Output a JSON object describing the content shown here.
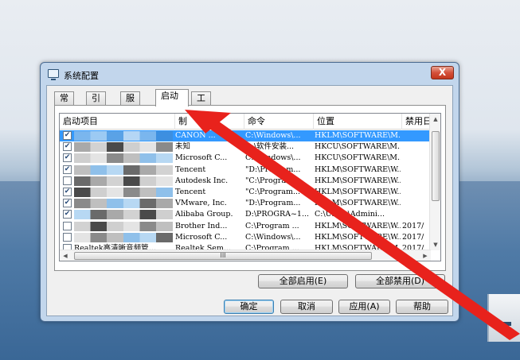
{
  "window": {
    "title": "系统配置",
    "close_glyph": "X"
  },
  "tabs": [
    {
      "label": "常规",
      "active": false
    },
    {
      "label": "引导",
      "active": false
    },
    {
      "label": "服务",
      "active": false
    },
    {
      "label": "启动",
      "active": true
    },
    {
      "label": "工具",
      "active": false
    }
  ],
  "table": {
    "columns": [
      "启动项目",
      "制",
      "命令",
      "位置",
      "禁用日"
    ],
    "rows": [
      {
        "checked": true,
        "name": "",
        "manufacturer": "CANON ...",
        "command": "C:\\Windows\\...",
        "location": "HKLM\\SOFTWARE\\M...",
        "date": "",
        "selected": true
      },
      {
        "checked": true,
        "name": "",
        "manufacturer": "未知",
        "command": "D:\\软件安装...",
        "location": "HKCU\\SOFTWARE\\M...",
        "date": "",
        "selected": false
      },
      {
        "checked": true,
        "name": "",
        "manufacturer": "Microsoft C...",
        "command": "C:\\Windows\\...",
        "location": "HKCU\\SOFTWARE\\M...",
        "date": "",
        "selected": false
      },
      {
        "checked": true,
        "name": "",
        "manufacturer": "Tencent",
        "command": "\"D:\\Program...",
        "location": "HKLM\\SOFTWARE\\W...",
        "date": "",
        "selected": false
      },
      {
        "checked": false,
        "name": "",
        "manufacturer": "Autodesk Inc.",
        "command": "\"C:\\Program...",
        "location": "HKLM\\SOFTWARE\\W...",
        "date": "",
        "selected": false
      },
      {
        "checked": true,
        "name": "",
        "manufacturer": "Tencent",
        "command": "\"C:\\Program...",
        "location": "HKLM\\SOFTWARE\\W...",
        "date": "",
        "selected": false
      },
      {
        "checked": true,
        "name": "",
        "manufacturer": "VMware, Inc.",
        "command": "\"D:\\Program...",
        "location": "HKLM\\SOFTWARE\\W...",
        "date": "",
        "selected": false
      },
      {
        "checked": true,
        "name": "",
        "manufacturer": "Alibaba Group.",
        "command": "D:\\PROGRA~1...",
        "location": "C:\\Users\\Admini...",
        "date": "",
        "selected": false
      },
      {
        "checked": false,
        "name": "",
        "manufacturer": "Brother Ind...",
        "command": "C:\\Program ...",
        "location": "HKLM\\SOFTWARE\\W...",
        "date": "2017/",
        "selected": false
      },
      {
        "checked": false,
        "name": "",
        "manufacturer": "Microsoft C...",
        "command": "C:\\Windows\\...",
        "location": "HKLM\\SOFTWARE\\W...",
        "date": "2017/",
        "selected": false
      },
      {
        "checked": false,
        "name": "Realtek高清晰音频管...",
        "manufacturer": "Realtek Sem...",
        "command": "C:\\Program ...",
        "location": "HKLM\\SOFTWARE\\M...",
        "date": "2017/",
        "selected": false
      }
    ],
    "hscroll_grip": "III"
  },
  "buttons": {
    "enable_all": "全部启用(E)",
    "disable_all": "全部禁用(D)",
    "ok": "确定",
    "cancel": "取消",
    "apply": "应用(A)",
    "help": "帮助"
  },
  "colors": {
    "selection": "#3399ff",
    "annotation_arrow": "#e8221c"
  }
}
